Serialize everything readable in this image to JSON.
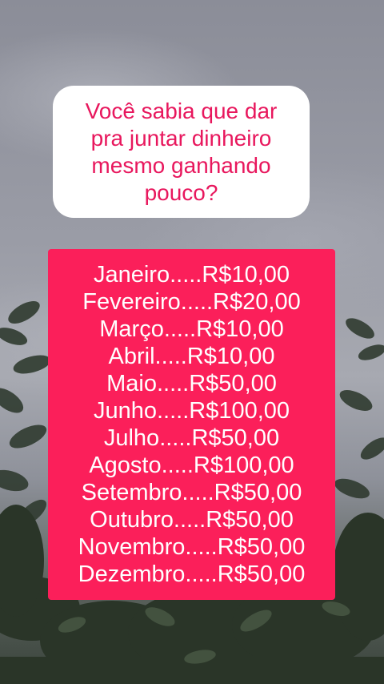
{
  "question": "Você sabia que dar\npra juntar dinheiro\nmesmo ganhando\npouco?",
  "months": [
    {
      "text": "Janeiro.....R$10,00"
    },
    {
      "text": "Fevereiro.....R$20,00"
    },
    {
      "text": "Março.....R$10,00"
    },
    {
      "text": "Abril.....R$10,00"
    },
    {
      "text": "Maio.....R$50,00"
    },
    {
      "text": "Junho.....R$100,00"
    },
    {
      "text": "Julho.....R$50,00"
    },
    {
      "text": "Agosto.....R$100,00"
    },
    {
      "text": "Setembro.....R$50,00"
    },
    {
      "text": "Outubro.....R$50,00"
    },
    {
      "text": "Novembro.....R$50,00"
    },
    {
      "text": "Dezembro.....R$50,00"
    }
  ],
  "colors": {
    "accent": "#fb1f5a",
    "question_text": "#e8175d",
    "bubble": "#ffffff"
  }
}
